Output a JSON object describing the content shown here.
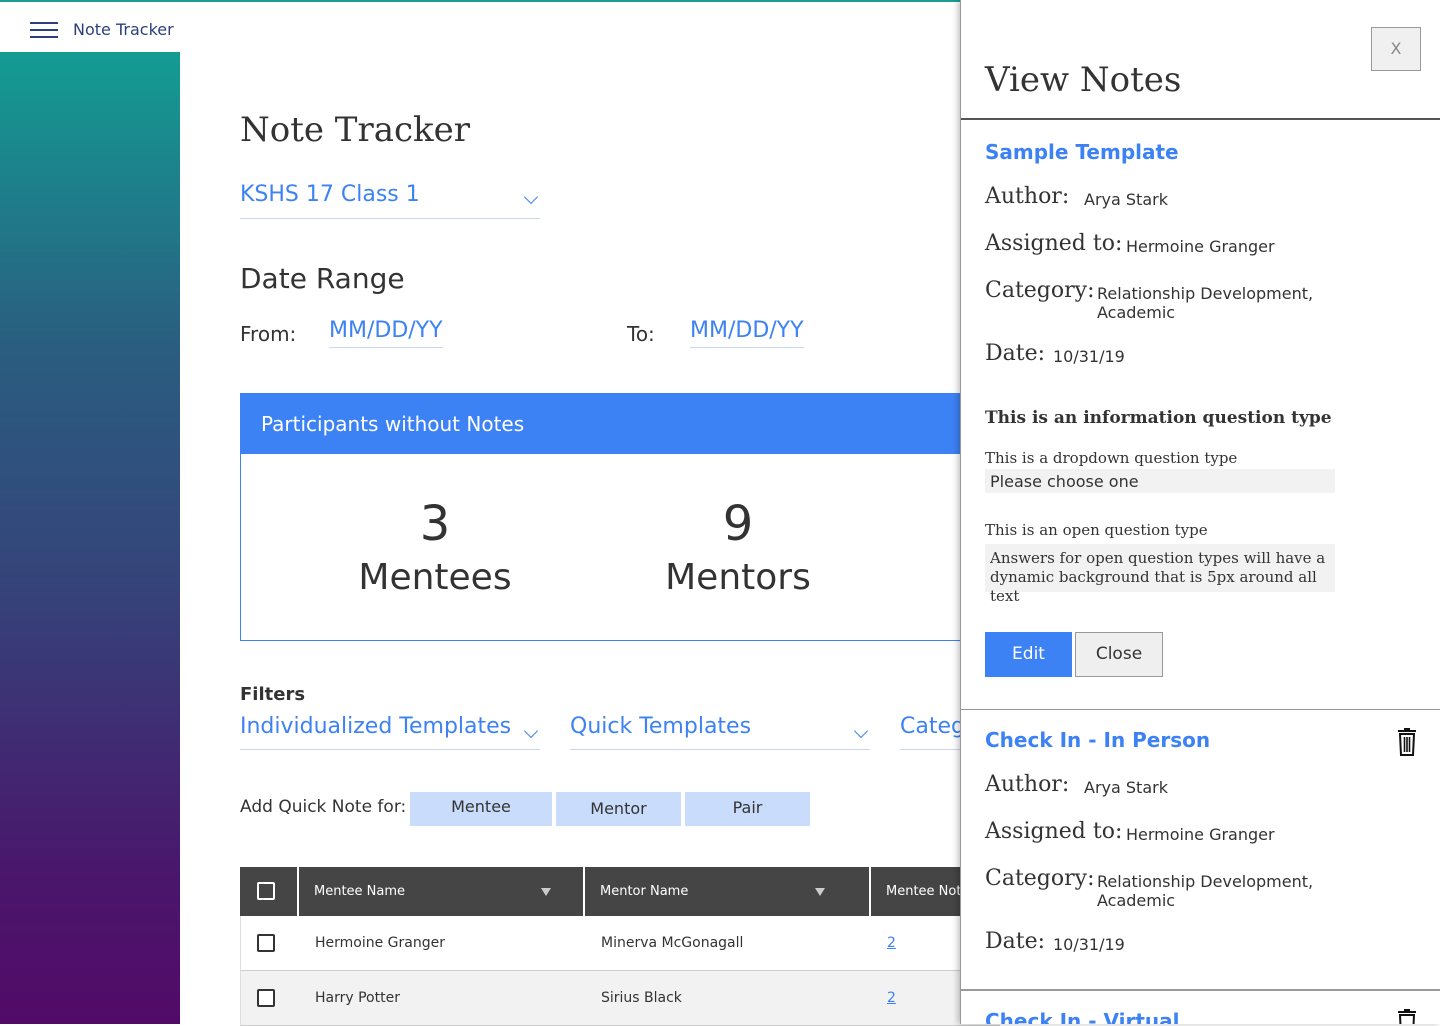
{
  "app": {
    "title": "Note Tracker"
  },
  "page": {
    "title": "Note Tracker",
    "class_select": "KSHS 17 Class 1",
    "date_range_title": "Date Range",
    "from_label": "From:",
    "from_value": "MM/DD/YY",
    "to_label": "To:",
    "to_value": "MM/DD/YY"
  },
  "participants": {
    "header": "Participants without Notes",
    "mentees_count": "3",
    "mentees_label": "Mentees",
    "mentors_count": "9",
    "mentors_label": "Mentors"
  },
  "filters": {
    "title": "Filters",
    "items": [
      "Individualized Templates",
      "Quick Templates",
      "Categ"
    ]
  },
  "quick_note": {
    "label": "Add Quick Note for:",
    "buttons": [
      "Mentee",
      "Mentor",
      "Pair"
    ]
  },
  "table": {
    "headers": [
      "Mentee Name",
      "Mentor Name",
      "Mentee Note"
    ],
    "rows": [
      {
        "mentee": "Hermoine Granger",
        "mentor": "Minerva McGonagall",
        "notes": "2"
      },
      {
        "mentee": "Harry Potter",
        "mentor": "Sirius Black",
        "notes": "2"
      }
    ]
  },
  "panel": {
    "title": "View Notes",
    "close_label": "X",
    "labels": {
      "author": "Author:",
      "assigned": "Assigned to:",
      "category": "Category:",
      "date": "Date:"
    },
    "notes": [
      {
        "title": "Sample Template",
        "author": "Arya Stark",
        "assigned": "Hermoine Granger",
        "category_line1": "Relationship Development,",
        "category_line2": "Academic",
        "date": "10/31/19",
        "info_question": "This is an information question type",
        "dropdown_label": "This is a dropdown question type",
        "dropdown_value": "Please choose one",
        "open_label": "This is an open question type",
        "open_answer_line1": "Answers for open question types will have a",
        "open_answer_line2": "dynamic background that is 5px around all text",
        "edit_label": "Edit",
        "close_label": "Close"
      },
      {
        "title": "Check In - In Person",
        "author": "Arya Stark",
        "assigned": "Hermoine Granger",
        "category_line1": "Relationship Development,",
        "category_line2": "Academic",
        "date": "10/31/19"
      },
      {
        "title": "Check In - Virtual"
      }
    ]
  },
  "colors": {
    "accent": "#3d82f5",
    "header_dark": "#454545",
    "quick_button": "#c9dcfb"
  }
}
